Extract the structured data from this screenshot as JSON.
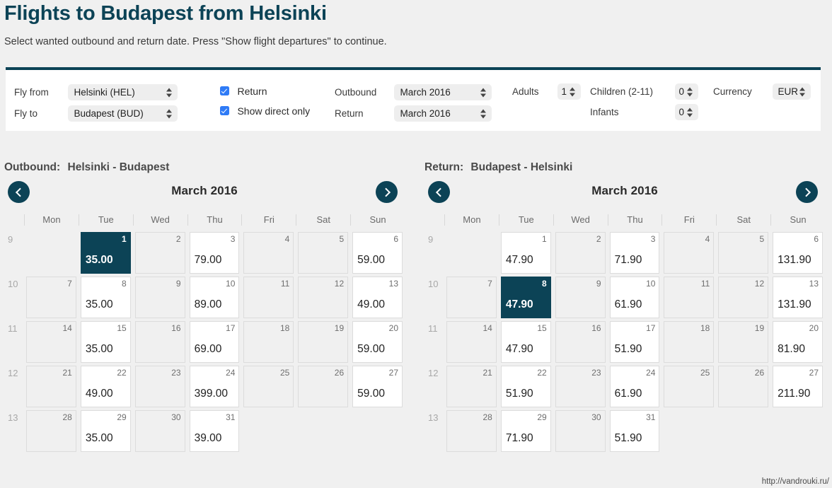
{
  "header": {
    "title": "Flights to Budapest from Helsinki",
    "subtitle": "Select wanted outbound and return date. Press \"Show flight departures\" to continue."
  },
  "search_form": {
    "fly_from_label": "Fly from",
    "fly_from_value": "Helsinki (HEL)",
    "fly_to_label": "Fly to",
    "fly_to_value": "Budapest (BUD)",
    "return_checkbox_label": "Return",
    "return_checked": true,
    "direct_checkbox_label": "Show direct only",
    "direct_checked": true,
    "outbound_label": "Outbound",
    "outbound_value": "March 2016",
    "return_label": "Return",
    "return_value": "March 2016",
    "adults_label": "Adults",
    "adults_value": "1",
    "children_label": "Children (2-11)",
    "children_value": "0",
    "infants_label": "Infants",
    "infants_value": "0",
    "currency_label": "Currency",
    "currency_value": "EUR"
  },
  "calendars": {
    "outbound": {
      "heading_direction": "Outbound:",
      "heading_route": "Helsinki - Budapest",
      "month": "March 2016",
      "prev_icon": "chevron-left-icon",
      "next_icon": "chevron-right-icon",
      "dow": [
        "Mon",
        "Tue",
        "Wed",
        "Thu",
        "Fri",
        "Sat",
        "Sun"
      ],
      "weeks": [
        {
          "week_number": "9",
          "days": [
            {
              "day": "",
              "price": "",
              "state": "empty"
            },
            {
              "day": "1",
              "price": "35.00",
              "state": "selected"
            },
            {
              "day": "2",
              "price": "",
              "state": "noprice"
            },
            {
              "day": "3",
              "price": "79.00",
              "state": "priced"
            },
            {
              "day": "4",
              "price": "",
              "state": "noprice"
            },
            {
              "day": "5",
              "price": "",
              "state": "noprice"
            },
            {
              "day": "6",
              "price": "59.00",
              "state": "priced"
            }
          ]
        },
        {
          "week_number": "10",
          "days": [
            {
              "day": "7",
              "price": "",
              "state": "noprice"
            },
            {
              "day": "8",
              "price": "35.00",
              "state": "priced"
            },
            {
              "day": "9",
              "price": "",
              "state": "noprice"
            },
            {
              "day": "10",
              "price": "89.00",
              "state": "priced"
            },
            {
              "day": "11",
              "price": "",
              "state": "noprice"
            },
            {
              "day": "12",
              "price": "",
              "state": "noprice"
            },
            {
              "day": "13",
              "price": "49.00",
              "state": "priced"
            }
          ]
        },
        {
          "week_number": "11",
          "days": [
            {
              "day": "14",
              "price": "",
              "state": "noprice"
            },
            {
              "day": "15",
              "price": "35.00",
              "state": "priced"
            },
            {
              "day": "16",
              "price": "",
              "state": "noprice"
            },
            {
              "day": "17",
              "price": "69.00",
              "state": "priced"
            },
            {
              "day": "18",
              "price": "",
              "state": "noprice"
            },
            {
              "day": "19",
              "price": "",
              "state": "noprice"
            },
            {
              "day": "20",
              "price": "59.00",
              "state": "priced"
            }
          ]
        },
        {
          "week_number": "12",
          "days": [
            {
              "day": "21",
              "price": "",
              "state": "noprice"
            },
            {
              "day": "22",
              "price": "49.00",
              "state": "priced"
            },
            {
              "day": "23",
              "price": "",
              "state": "noprice"
            },
            {
              "day": "24",
              "price": "399.00",
              "state": "priced"
            },
            {
              "day": "25",
              "price": "",
              "state": "noprice"
            },
            {
              "day": "26",
              "price": "",
              "state": "noprice"
            },
            {
              "day": "27",
              "price": "59.00",
              "state": "priced"
            }
          ]
        },
        {
          "week_number": "13",
          "days": [
            {
              "day": "28",
              "price": "",
              "state": "noprice"
            },
            {
              "day": "29",
              "price": "35.00",
              "state": "priced"
            },
            {
              "day": "30",
              "price": "",
              "state": "noprice"
            },
            {
              "day": "31",
              "price": "39.00",
              "state": "priced"
            },
            {
              "day": "",
              "price": "",
              "state": "empty"
            },
            {
              "day": "",
              "price": "",
              "state": "empty"
            },
            {
              "day": "",
              "price": "",
              "state": "empty"
            }
          ]
        }
      ]
    },
    "return": {
      "heading_direction": "Return:",
      "heading_route": "Budapest - Helsinki",
      "month": "March 2016",
      "prev_icon": "chevron-left-icon",
      "next_icon": "chevron-right-icon",
      "dow": [
        "Mon",
        "Tue",
        "Wed",
        "Thu",
        "Fri",
        "Sat",
        "Sun"
      ],
      "weeks": [
        {
          "week_number": "9",
          "days": [
            {
              "day": "",
              "price": "",
              "state": "empty"
            },
            {
              "day": "1",
              "price": "47.90",
              "state": "priced"
            },
            {
              "day": "2",
              "price": "",
              "state": "noprice"
            },
            {
              "day": "3",
              "price": "71.90",
              "state": "priced"
            },
            {
              "day": "4",
              "price": "",
              "state": "noprice"
            },
            {
              "day": "5",
              "price": "",
              "state": "noprice"
            },
            {
              "day": "6",
              "price": "131.90",
              "state": "priced"
            }
          ]
        },
        {
          "week_number": "10",
          "days": [
            {
              "day": "7",
              "price": "",
              "state": "noprice"
            },
            {
              "day": "8",
              "price": "47.90",
              "state": "selected"
            },
            {
              "day": "9",
              "price": "",
              "state": "noprice"
            },
            {
              "day": "10",
              "price": "61.90",
              "state": "priced"
            },
            {
              "day": "11",
              "price": "",
              "state": "noprice"
            },
            {
              "day": "12",
              "price": "",
              "state": "noprice"
            },
            {
              "day": "13",
              "price": "131.90",
              "state": "priced"
            }
          ]
        },
        {
          "week_number": "11",
          "days": [
            {
              "day": "14",
              "price": "",
              "state": "noprice"
            },
            {
              "day": "15",
              "price": "47.90",
              "state": "priced"
            },
            {
              "day": "16",
              "price": "",
              "state": "noprice"
            },
            {
              "day": "17",
              "price": "51.90",
              "state": "priced"
            },
            {
              "day": "18",
              "price": "",
              "state": "noprice"
            },
            {
              "day": "19",
              "price": "",
              "state": "noprice"
            },
            {
              "day": "20",
              "price": "81.90",
              "state": "priced"
            }
          ]
        },
        {
          "week_number": "12",
          "days": [
            {
              "day": "21",
              "price": "",
              "state": "noprice"
            },
            {
              "day": "22",
              "price": "51.90",
              "state": "priced"
            },
            {
              "day": "23",
              "price": "",
              "state": "noprice"
            },
            {
              "day": "24",
              "price": "61.90",
              "state": "priced"
            },
            {
              "day": "25",
              "price": "",
              "state": "noprice"
            },
            {
              "day": "26",
              "price": "",
              "state": "noprice"
            },
            {
              "day": "27",
              "price": "211.90",
              "state": "priced"
            }
          ]
        },
        {
          "week_number": "13",
          "days": [
            {
              "day": "28",
              "price": "",
              "state": "noprice"
            },
            {
              "day": "29",
              "price": "71.90",
              "state": "priced"
            },
            {
              "day": "30",
              "price": "",
              "state": "noprice"
            },
            {
              "day": "31",
              "price": "51.90",
              "state": "priced"
            },
            {
              "day": "",
              "price": "",
              "state": "empty"
            },
            {
              "day": "",
              "price": "",
              "state": "empty"
            },
            {
              "day": "",
              "price": "",
              "state": "empty"
            }
          ]
        }
      ]
    }
  },
  "watermark": "http://vandrouki.ru/",
  "colors": {
    "accent_dark": "#0c4356",
    "checkbox_blue": "#2f7bf6",
    "page_background": "#f0f0f0",
    "panel_background": "#ffffff",
    "cell_border": "#dcdcdc"
  }
}
